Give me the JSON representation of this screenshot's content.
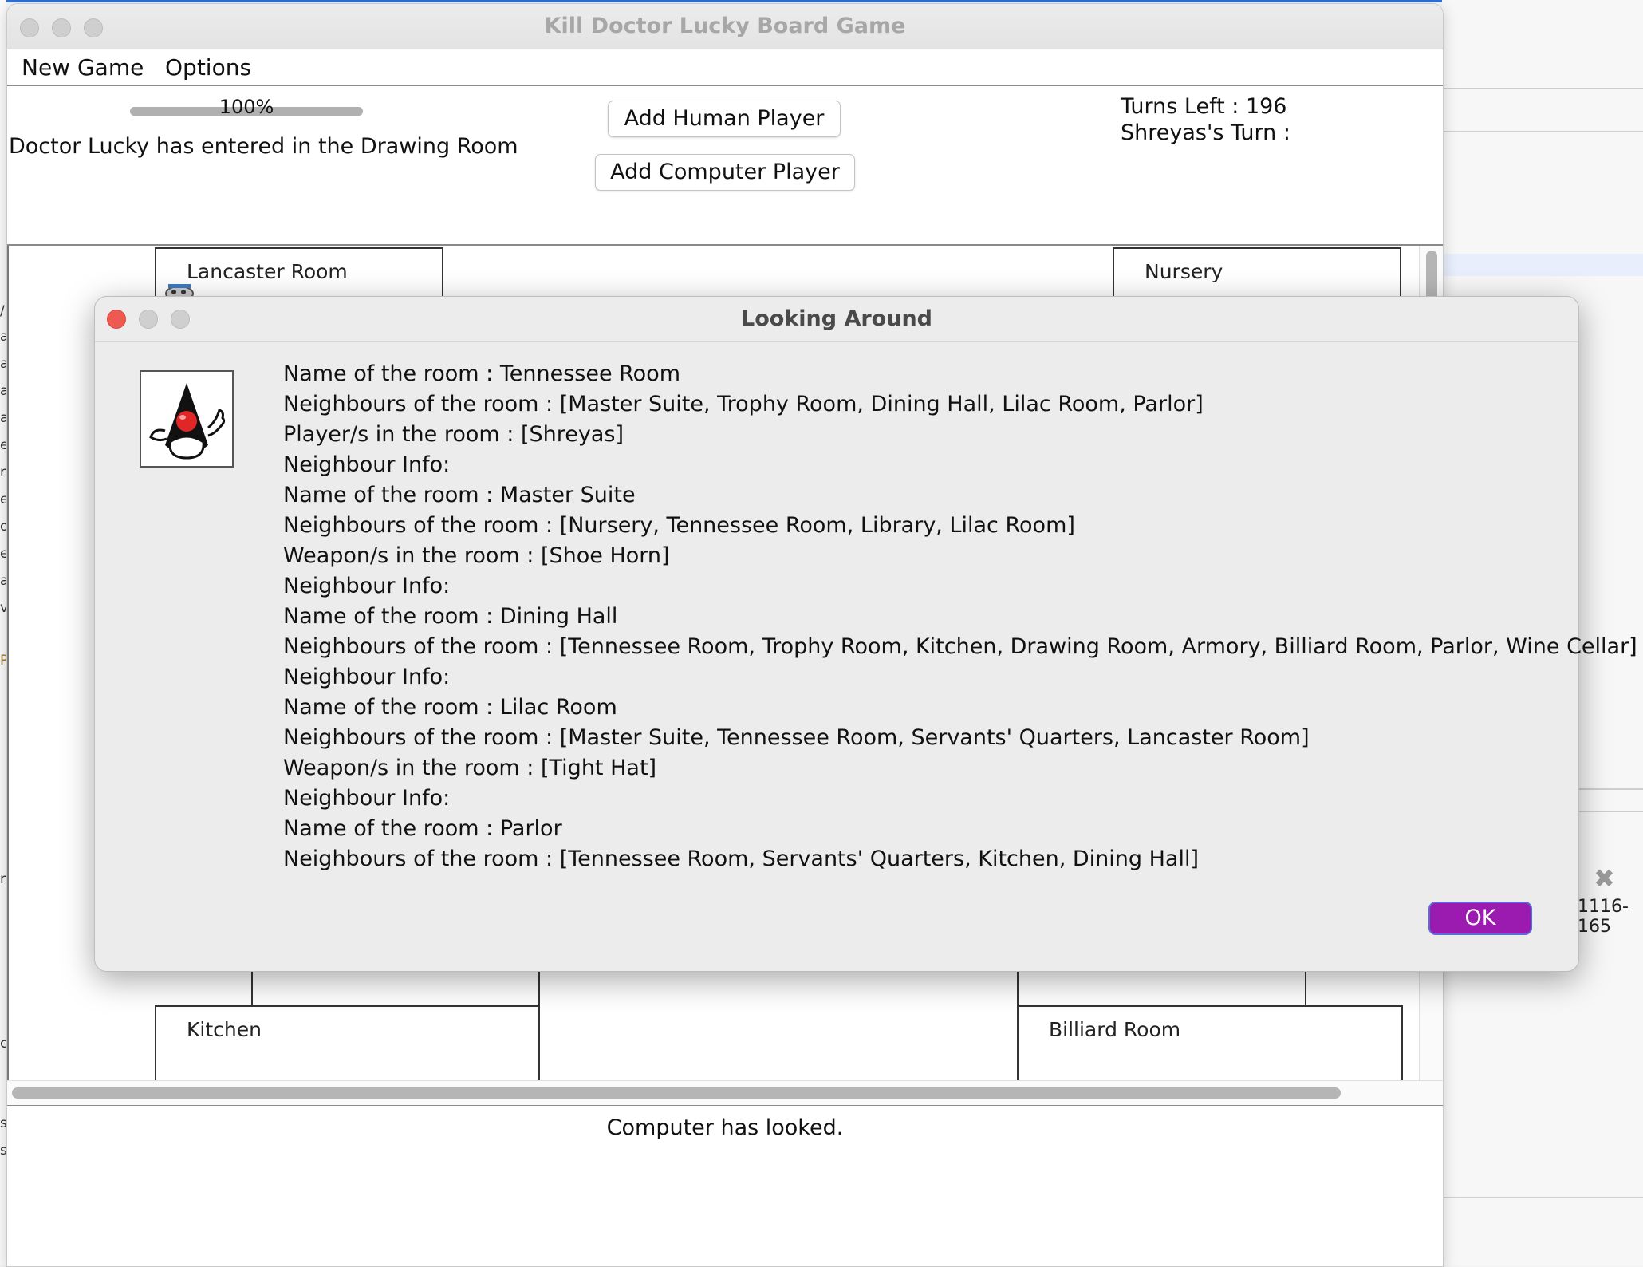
{
  "window": {
    "title": "Kill Doctor Lucky Board Game"
  },
  "menu": {
    "items": [
      "New Game",
      "Options"
    ]
  },
  "top_panel": {
    "progress_percent": 100,
    "progress_label": "100%",
    "status_message": "Doctor Lucky has entered in the Drawing Room",
    "add_human_label": "Add Human Player",
    "add_computer_label": "Add Computer Player",
    "turns_left": "Turns Left : 196",
    "current_turn": "Shreyas's Turn :"
  },
  "board": {
    "rooms": {
      "lancaster": "Lancaster Room",
      "nursery": "Nursery",
      "kitchen": "Kitchen",
      "billiard": "Billiard Room"
    }
  },
  "bottom_panel": {
    "message": "Computer has looked."
  },
  "dialog": {
    "title": "Looking Around",
    "icon": "java-duke-icon",
    "lines": [
      "Name of the room : Tennessee Room",
      "Neighbours of the room : [Master Suite, Trophy Room, Dining Hall, Lilac Room, Parlor]",
      "Player/s in the room : [Shreyas]",
      "Neighbour Info:",
      "Name of the room : Master Suite",
      "Neighbours of the room : [Nursery, Tennessee Room, Library, Lilac Room]",
      "Weapon/s in the room : [Shoe Horn]",
      "Neighbour Info:",
      "Name of the room : Dining Hall",
      "Neighbours of the room : [Tennessee Room, Trophy Room, Kitchen, Drawing Room, Armory, Billiard Room, Parlor, Wine Cellar]",
      "Neighbour Info:",
      "Name of the room : Lilac Room",
      "Neighbours of the room : [Master Suite, Tennessee Room, Servants' Quarters, Lancaster Room]",
      "Weapon/s in the room : [Tight Hat]",
      "Neighbour Info:",
      "Name of the room : Parlor",
      "Neighbours of the room : [Tennessee Room, Servants' Quarters, Kitchen, Dining Hall]"
    ],
    "ok_label": "OK"
  },
  "background": {
    "edge_chars": [
      "/",
      "a",
      "a",
      "a",
      "a",
      "e",
      "r",
      "el",
      "o",
      "e",
      "a",
      "v",
      "R",
      "n",
      "c",
      "s",
      "s"
    ],
    "partial_text": "1116-165",
    "close_glyph": "✖"
  },
  "colors": {
    "ok_button": "#9b1ab0",
    "close_button": "#ee5a52",
    "accent_blue": "#2f6fd6"
  }
}
